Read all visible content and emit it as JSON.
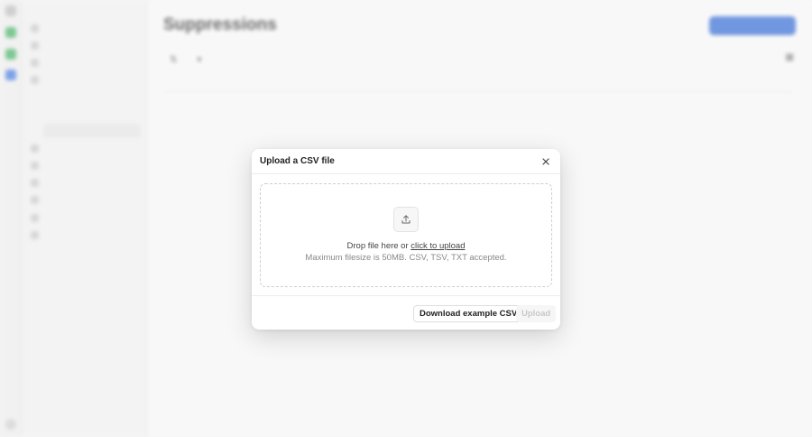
{
  "colors": {
    "accent": "#3b6fd4",
    "overlay": "rgba(255,255,255,0.28)"
  },
  "background": {
    "page_title": "Suppressions"
  },
  "modal": {
    "title": "Upload a CSV file",
    "close_icon": "close-icon",
    "upload_icon": "upload-icon",
    "drop_text": "Drop file here or",
    "drop_link": "click to upload",
    "limit_text": "Maximum filesize is 50MB. CSV, TSV, TXT accepted.",
    "download_label": "Download example CSV",
    "upload_label": "Upload"
  }
}
